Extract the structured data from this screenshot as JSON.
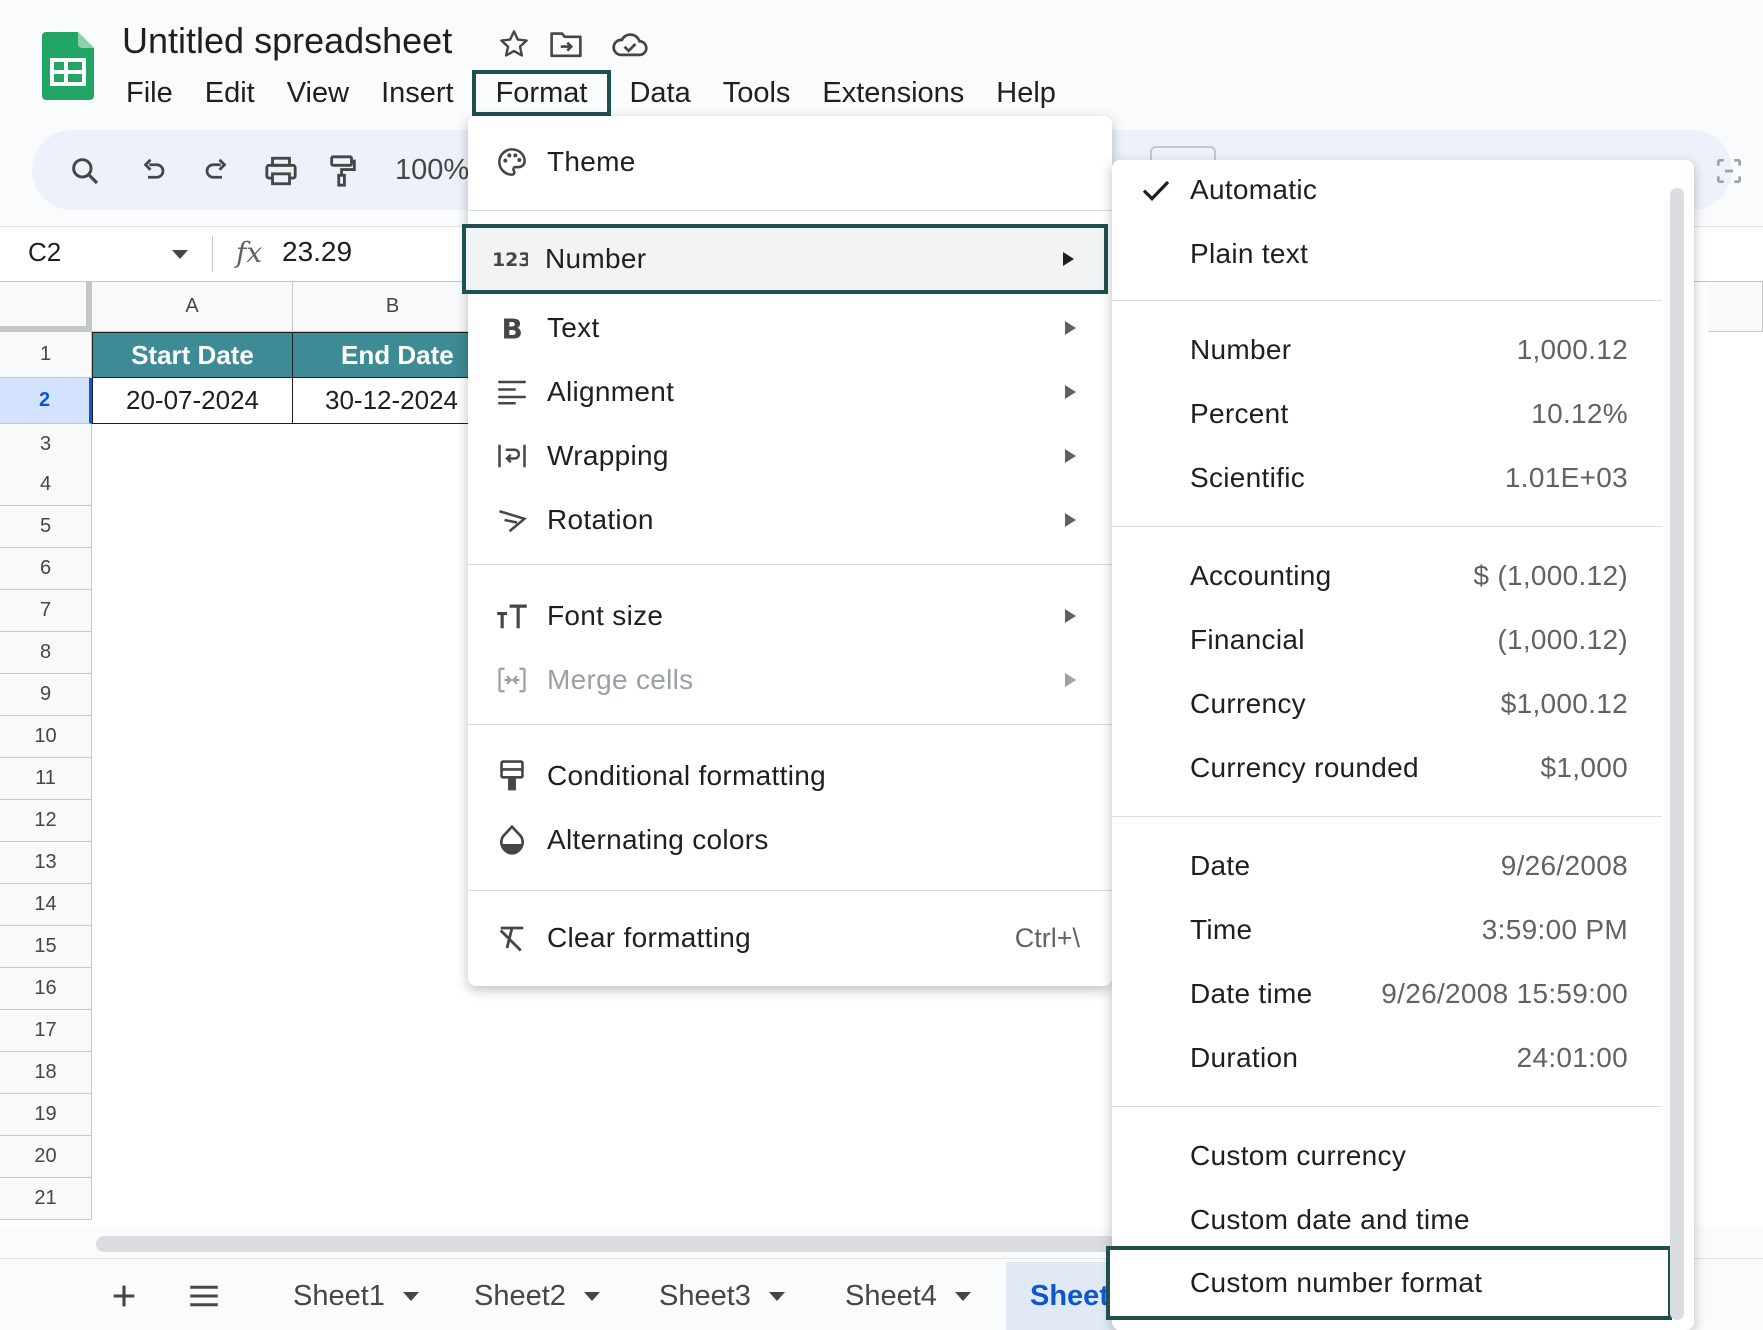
{
  "doc": {
    "title": "Untitled spreadsheet"
  },
  "menubar": [
    "File",
    "Edit",
    "View",
    "Insert",
    "Format",
    "Data",
    "Tools",
    "Extensions",
    "Help"
  ],
  "toolbar": {
    "zoom": "100%"
  },
  "formula": {
    "cell_ref": "C2",
    "fx": "fx",
    "value": "23.29"
  },
  "grid": {
    "columns": [
      "A",
      "B"
    ],
    "rows": [
      "1",
      "2",
      "3",
      "4",
      "5",
      "6",
      "7",
      "8",
      "9",
      "10",
      "11",
      "12",
      "13",
      "14",
      "15",
      "16",
      "17",
      "18",
      "19",
      "20",
      "21"
    ],
    "header": [
      "Start Date",
      "End Date"
    ],
    "row2": [
      "20-07-2024",
      "30-12-2024"
    ]
  },
  "sheets": [
    "Sheet1",
    "Sheet2",
    "Sheet3",
    "Sheet4",
    "Sheet"
  ],
  "format_menu": {
    "theme": "Theme",
    "number": "Number",
    "text": "Text",
    "alignment": "Alignment",
    "wrapping": "Wrapping",
    "rotation": "Rotation",
    "font_size": "Font size",
    "merge_cells": "Merge cells",
    "conditional_formatting": "Conditional formatting",
    "alternating_colors": "Alternating colors",
    "clear_formatting": "Clear formatting",
    "clear_formatting_shortcut": "Ctrl+\\"
  },
  "number_menu": {
    "automatic": "Automatic",
    "plain_text": "Plain text",
    "number": {
      "label": "Number",
      "example": "1,000.12"
    },
    "percent": {
      "label": "Percent",
      "example": "10.12%"
    },
    "scientific": {
      "label": "Scientific",
      "example": "1.01E+03"
    },
    "accounting": {
      "label": "Accounting",
      "example": "$ (1,000.12)"
    },
    "financial": {
      "label": "Financial",
      "example": "(1,000.12)"
    },
    "currency": {
      "label": "Currency",
      "example": "$1,000.12"
    },
    "currency_rounded": {
      "label": "Currency rounded",
      "example": "$1,000"
    },
    "date": {
      "label": "Date",
      "example": "9/26/2008"
    },
    "time": {
      "label": "Time",
      "example": "3:59:00 PM"
    },
    "date_time": {
      "label": "Date time",
      "example": "9/26/2008 15:59:00"
    },
    "duration": {
      "label": "Duration",
      "example": "24:01:00"
    },
    "custom_currency": "Custom currency",
    "custom_date_time": "Custom date and time",
    "custom_number_format": "Custom number format"
  },
  "colors": {
    "header_fill": "#3d8b94",
    "highlight_border": "#1f5050",
    "accent": "#0b57d0",
    "logo": "#23a566"
  }
}
